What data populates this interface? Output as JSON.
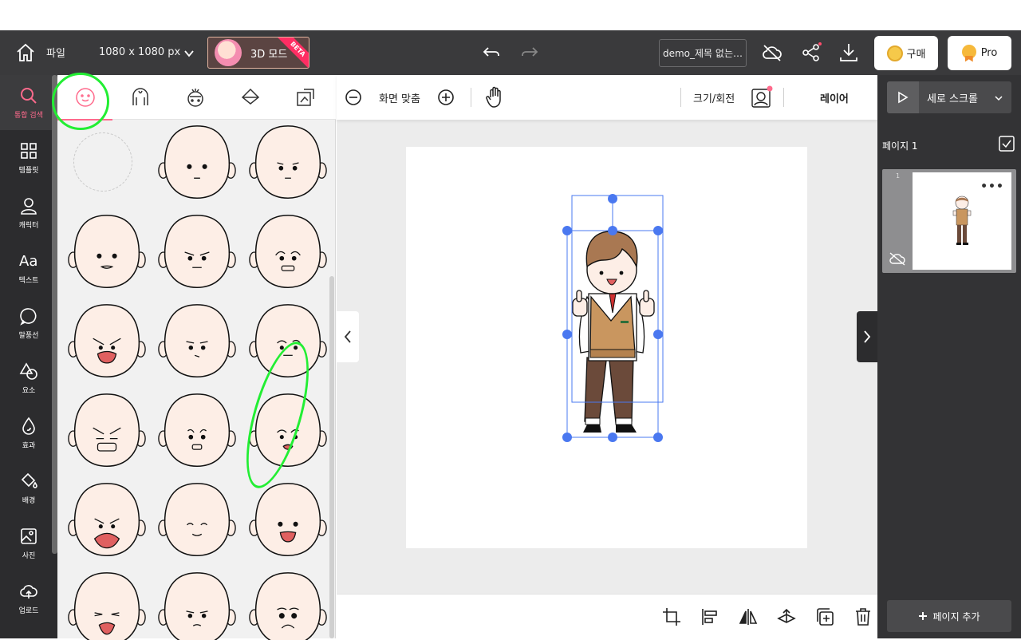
{
  "topbar": {
    "file_menu": "파일",
    "canvas_size": "1080 x 1080 px",
    "mode_label": "3D 모드",
    "beta_badge": "BETA",
    "doc_title": "demo_제목 없는…",
    "buy_label": "구매",
    "pro_label": "Pro"
  },
  "leftnav": {
    "items": [
      {
        "label": "통합 검색",
        "icon": "search-icon"
      },
      {
        "label": "템플릿",
        "icon": "grid-icon"
      },
      {
        "label": "캐릭터",
        "icon": "person-icon"
      },
      {
        "label": "텍스트",
        "icon": "text-icon"
      },
      {
        "label": "말풍선",
        "icon": "speech-bubble-icon"
      },
      {
        "label": "요소",
        "icon": "shapes-icon"
      },
      {
        "label": "효과",
        "icon": "drop-icon"
      },
      {
        "label": "배경",
        "icon": "paint-bucket-icon"
      },
      {
        "label": "사진",
        "icon": "image-icon"
      },
      {
        "label": "업로드",
        "icon": "cloud-upload-icon"
      }
    ]
  },
  "panel": {
    "tabs": [
      "face-icon",
      "hair-icon",
      "head-accessory-icon",
      "color-fill-icon",
      "transform-icon"
    ]
  },
  "canvas_toolbar": {
    "fit_label": "화면 맞춤",
    "size_rotate_label": "크기/회전",
    "layer_label": "레이어"
  },
  "rightpanel": {
    "scroll_mode": "세로 스크롤",
    "page_label": "페이지 1",
    "page_number": "1",
    "more": "•••",
    "add_page": "페이지 추가"
  },
  "colors": {
    "accent": "#ff6a8c",
    "selection": "#4a78f0",
    "annotation": "#22ee33"
  }
}
